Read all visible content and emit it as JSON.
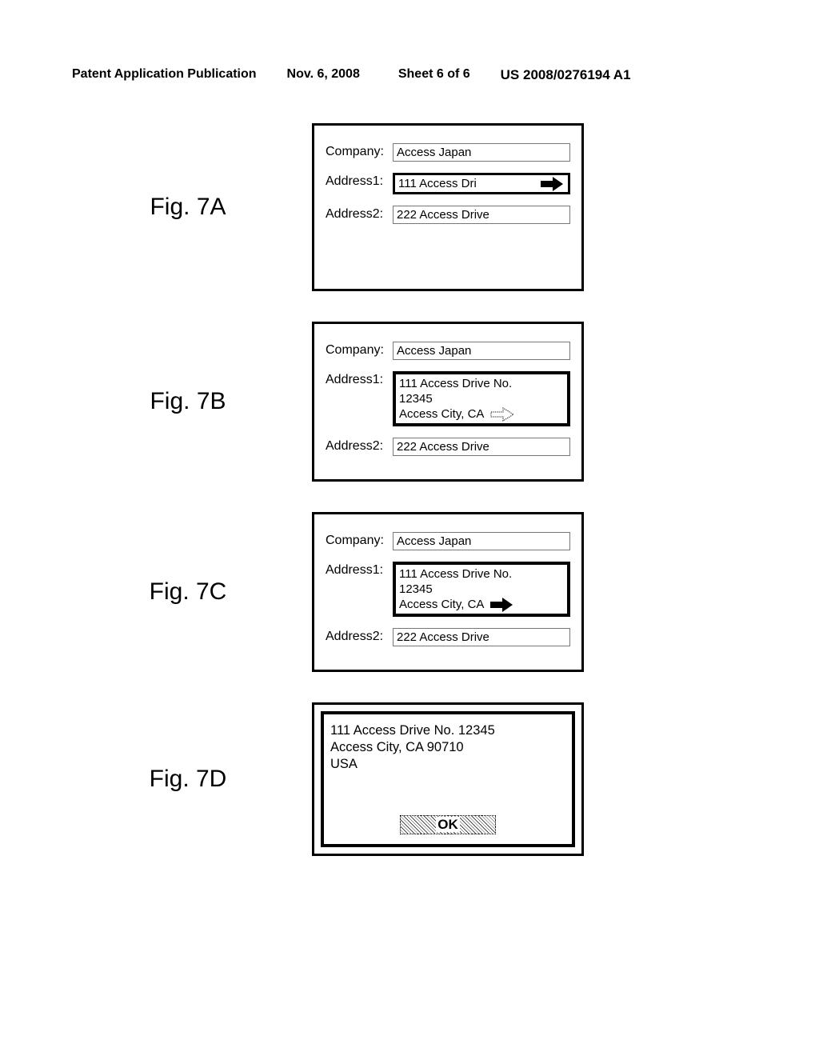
{
  "header": {
    "publication": "Patent Application Publication",
    "date": "Nov. 6, 2008",
    "sheet": "Sheet 6 of 6",
    "number": "US 2008/0276194 A1"
  },
  "labels": {
    "company": "Company:",
    "address1": "Address1:",
    "address2": "Address2:"
  },
  "figures": {
    "a": {
      "label": "Fig. 7A",
      "company": "Access Japan",
      "address1": "111 Access Dri",
      "address2": "222 Access Drive"
    },
    "b": {
      "label": "Fig. 7B",
      "company": "Access Japan",
      "address1_line1": "111 Access Drive No.",
      "address1_line2": "12345",
      "address1_line3": "Access City, CA",
      "address2": "222 Access Drive"
    },
    "c": {
      "label": "Fig. 7C",
      "company": "Access Japan",
      "address1_line1": "111 Access Drive No.",
      "address1_line2": "12345",
      "address1_line3": "Access City, CA",
      "address2": "222 Access Drive"
    },
    "d": {
      "label": "Fig. 7D",
      "line1": "111 Access Drive No. 12345",
      "line2": "Access City, CA 90710",
      "line3": "USA",
      "ok": "OK"
    }
  }
}
